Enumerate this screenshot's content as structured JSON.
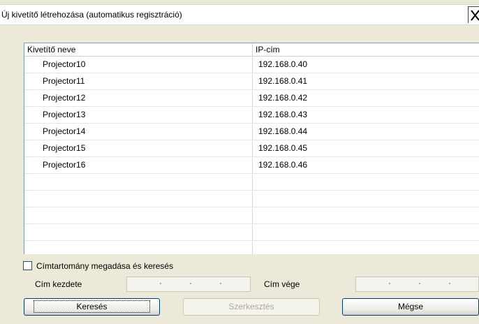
{
  "window": {
    "title": "Új kivetítő létrehozása (automatikus regisztráció)"
  },
  "list": {
    "columns": [
      "Kivetítő neve",
      "IP-cím"
    ],
    "rows": [
      {
        "name": "Projector10",
        "ip": "192.168.0.40"
      },
      {
        "name": "Projector11",
        "ip": "192.168.0.41"
      },
      {
        "name": "Projector12",
        "ip": "192.168.0.42"
      },
      {
        "name": "Projector13",
        "ip": "192.168.0.43"
      },
      {
        "name": "Projector14",
        "ip": "192.168.0.44"
      },
      {
        "name": "Projector15",
        "ip": "192.168.0.45"
      },
      {
        "name": "Projector16",
        "ip": "192.168.0.46"
      }
    ]
  },
  "range": {
    "checkbox_label": "Címtartomány megadása és keresés",
    "checked": false,
    "start_label": "Cím kezdete",
    "end_label": "Cím vége"
  },
  "buttons": {
    "search": "Keresés",
    "edit": "Szerkesztés",
    "cancel": "Mégse"
  }
}
